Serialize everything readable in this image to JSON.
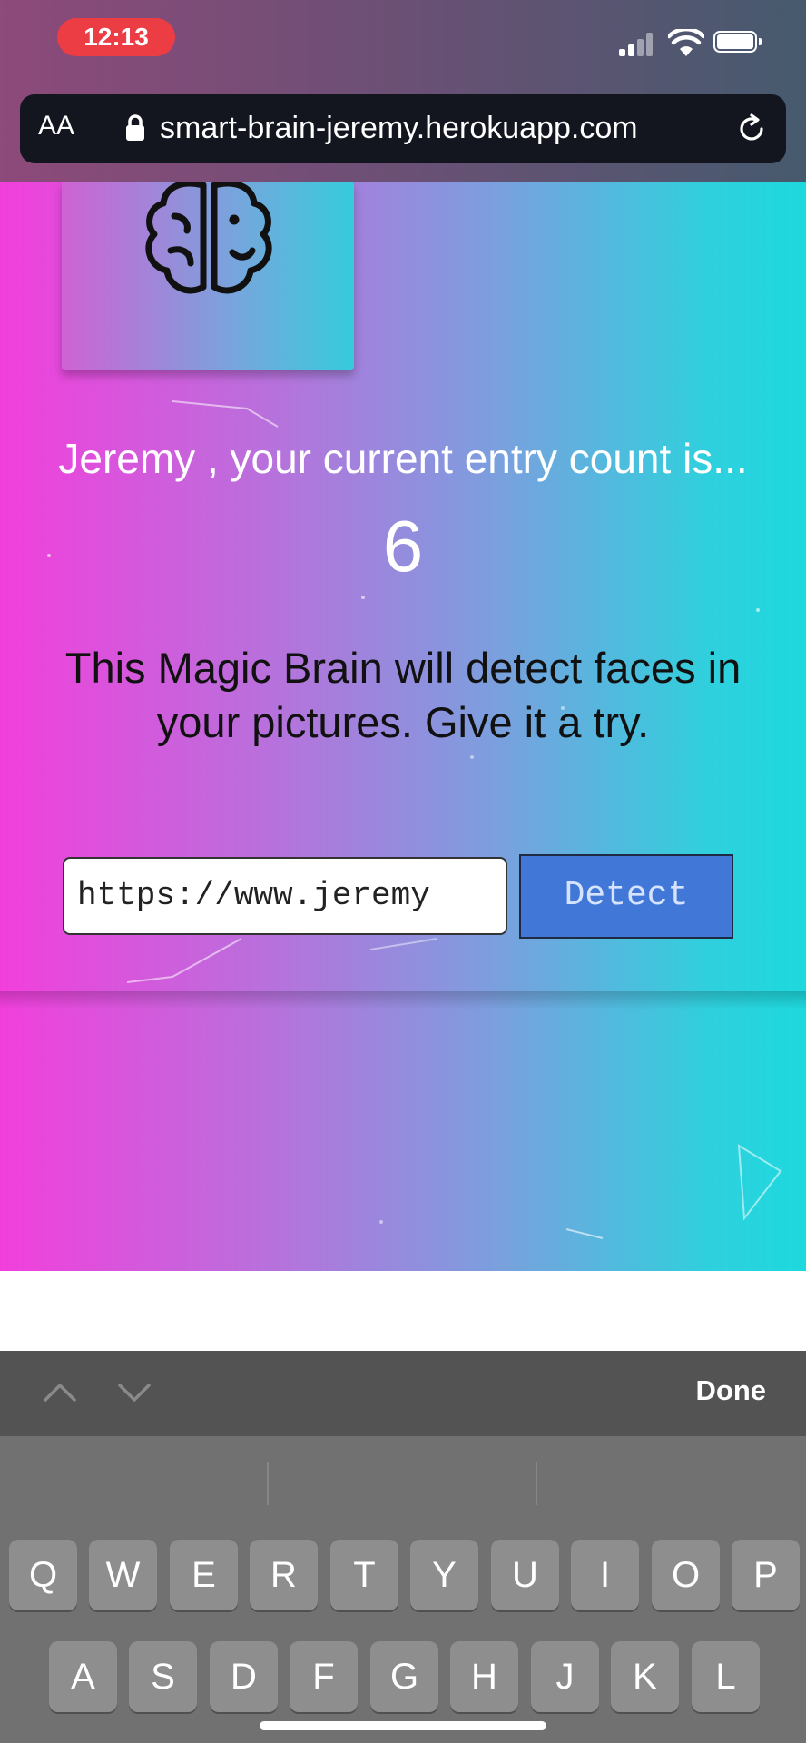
{
  "status_bar": {
    "time": "12:13"
  },
  "browser": {
    "text_size_label": "AA",
    "url": "smart-brain-jeremy.herokuapp.com"
  },
  "app": {
    "entry_message": "Jeremy , your current entry count is...",
    "entry_count": "6",
    "tagline_line1": "This Magic Brain will detect faces in",
    "tagline_line2": "your pictures. Give it a try.",
    "image_url_value": "https://www.jeremy",
    "detect_label": "Detect"
  },
  "keyboard_accessory": {
    "done_label": "Done"
  },
  "keyboard": {
    "row1": [
      "Q",
      "W",
      "E",
      "R",
      "T",
      "Y",
      "U",
      "I",
      "O",
      "P"
    ],
    "row2": [
      "A",
      "S",
      "D",
      "F",
      "G",
      "H",
      "J",
      "K",
      "L"
    ]
  },
  "icons": {
    "logo": "brain-icon",
    "lock": "lock-icon",
    "reload": "reload-icon",
    "signal": "cellular-signal-icon",
    "wifi": "wifi-icon",
    "battery": "battery-icon",
    "prev": "chevron-up-icon",
    "next": "chevron-down-icon"
  },
  "colors": {
    "gradient_start": "#f23fdc",
    "gradient_end": "#1dd9de",
    "detect_button": "#4178d8"
  }
}
